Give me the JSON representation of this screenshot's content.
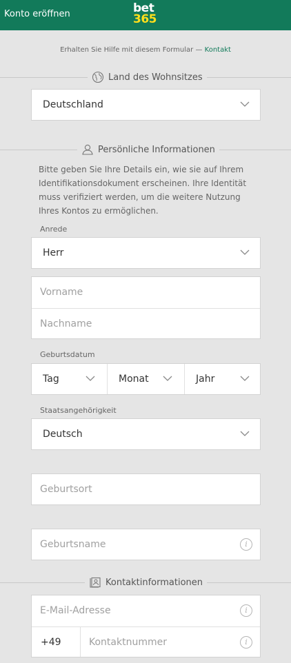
{
  "header": {
    "title": "Konto eröffnen",
    "logo_top": "bet",
    "logo_bottom": "365"
  },
  "help": {
    "text": "Erhalten Sie Hilfe mit diesem Formular — ",
    "link": "Kontakt"
  },
  "residence": {
    "heading": "Land des Wohnsitzes",
    "icon": "globe-icon",
    "value": "Deutschland"
  },
  "personal": {
    "heading": "Persönliche Informationen",
    "icon": "person-icon",
    "description": "Bitte geben Sie Ihre Details ein, wie sie auf Ihrem Identifikationsdokument erscheinen. Ihre Identität muss verifiziert werden, um die weitere Nutzung Ihres Kontos zu ermöglichen.",
    "salutation_label": "Anrede",
    "salutation_value": "Herr",
    "first_name_placeholder": "Vorname",
    "last_name_placeholder": "Nachname",
    "dob_label": "Geburtsdatum",
    "dob_day": "Tag",
    "dob_month": "Monat",
    "dob_year": "Jahr",
    "nationality_label": "Staatsangehörigkeit",
    "nationality_value": "Deutsch",
    "birthplace_placeholder": "Geburtsort",
    "birthname_placeholder": "Geburtsname"
  },
  "contact": {
    "heading": "Kontaktinformationen",
    "icon": "contact-card-icon",
    "email_placeholder": "E-Mail-Adresse",
    "phone_prefix": "+49",
    "phone_placeholder": "Kontaktnummer"
  },
  "colors": {
    "brand_green": "#127a5a",
    "logo_yellow": "#ffdf1b",
    "background": "#e5e5e5"
  }
}
